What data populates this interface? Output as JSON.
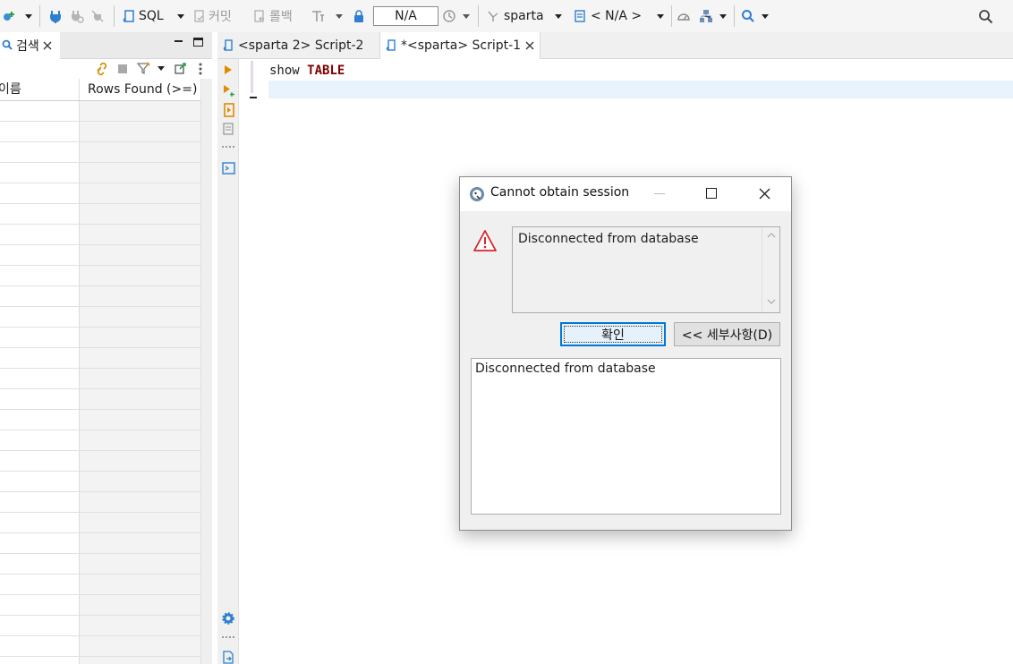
{
  "toolbar": {
    "sql_label": "SQL",
    "commit_label": "커밋",
    "rollback_label": "롤백",
    "transaction_mode": "N/A",
    "datasource": "sparta",
    "schema": "< N/A >"
  },
  "left_panel": {
    "tab_label": "검색",
    "columns": [
      "이름",
      "Rows Found (>=)"
    ]
  },
  "editor": {
    "tabs": [
      {
        "label": "<sparta 2> Script-2",
        "active": false
      },
      {
        "label": "*<sparta> Script-1",
        "active": true
      }
    ],
    "code_keyword": "show",
    "code_object": "TABLE"
  },
  "dialog": {
    "title": "Cannot obtain session",
    "message": "Disconnected from database",
    "ok_label": "확인",
    "details_label": "<< 세부사항(D)",
    "details_text": "Disconnected from database"
  },
  "colors": {
    "accent": "#0078d7",
    "warning": "#d9232d",
    "keyword": "#7f0000"
  }
}
